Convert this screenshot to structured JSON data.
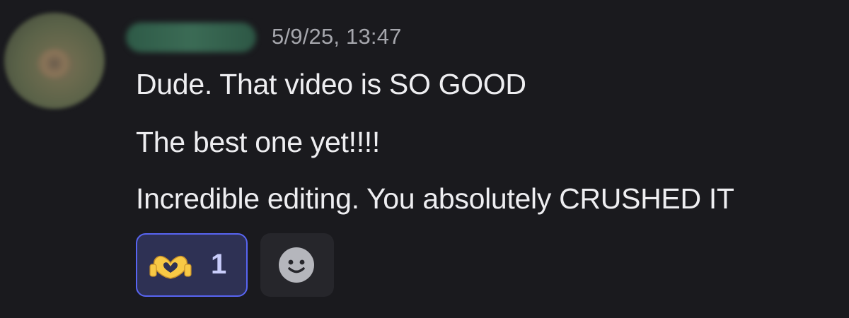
{
  "message": {
    "timestamp": "5/9/25, 13:47",
    "lines": [
      "Dude. That video is SO GOOD",
      "The best one yet!!!!",
      "Incredible editing. You absolutely CRUSHED IT"
    ]
  },
  "reactions": [
    {
      "emoji": "heart-hands-icon",
      "count": "1",
      "selected": true
    }
  ],
  "add_reaction": {
    "icon": "smile-face-icon"
  },
  "colors": {
    "background": "#1a1a1e",
    "reaction_border": "#5865f2",
    "reaction_bg": "#2e3154",
    "emoji_yellow": "#f8c945"
  }
}
